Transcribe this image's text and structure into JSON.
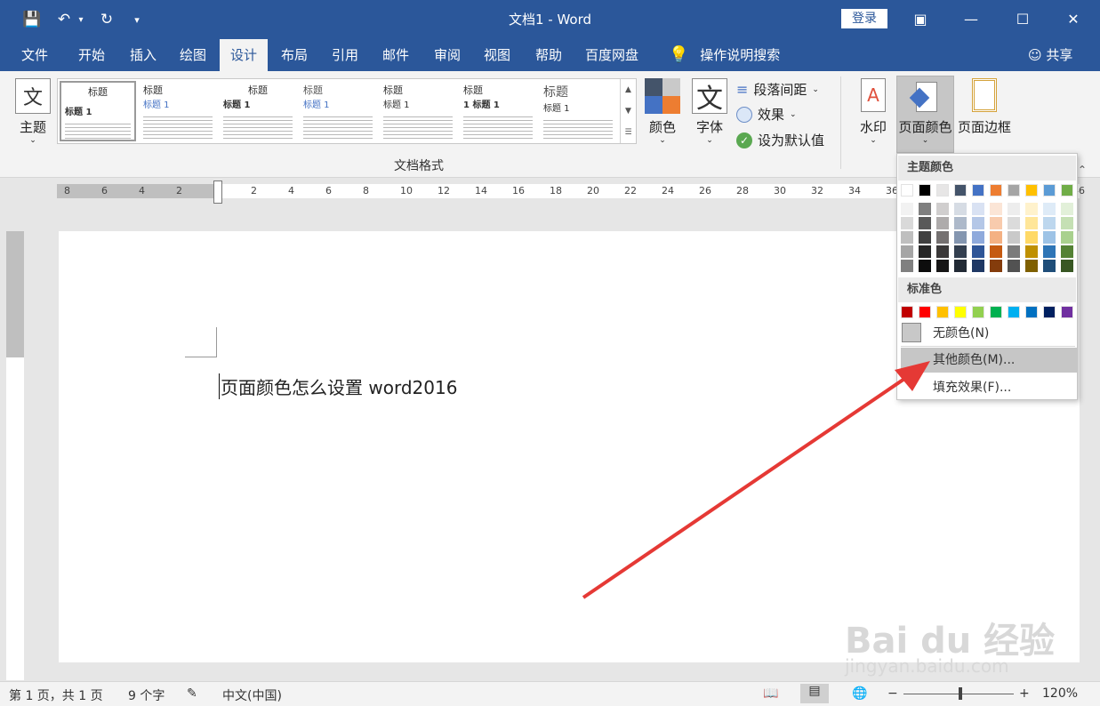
{
  "window": {
    "title": "文档1  -  Word",
    "login_label": "登录"
  },
  "tabs": [
    {
      "label": "文件"
    },
    {
      "label": "开始"
    },
    {
      "label": "插入"
    },
    {
      "label": "绘图"
    },
    {
      "label": "设计"
    },
    {
      "label": "布局"
    },
    {
      "label": "引用"
    },
    {
      "label": "邮件"
    },
    {
      "label": "审阅"
    },
    {
      "label": "视图"
    },
    {
      "label": "帮助"
    },
    {
      "label": "百度网盘"
    }
  ],
  "active_tab": "设计",
  "tell_me": "操作说明搜索",
  "share": "共享",
  "ribbon": {
    "theme_label": "主题",
    "style_thumbs": [
      {
        "heading": "标题",
        "sub": "标题 1"
      },
      {
        "heading": "标题",
        "sub": "标题 1"
      },
      {
        "heading": "标题",
        "sub": "标题 1"
      },
      {
        "heading": "标题",
        "sub": "标题 1"
      },
      {
        "heading": "标题",
        "sub": "标题 1"
      },
      {
        "heading": "标题",
        "sub": "1  标题 1"
      },
      {
        "heading": "标题",
        "sub": "标题 1"
      }
    ],
    "group_label": "文档格式",
    "colors_label": "颜色",
    "fonts_label": "字体",
    "fonts_icon_glyph": "文",
    "paragraph_spacing": "段落间距",
    "effects": "效果",
    "set_default": "设为默认值",
    "watermark": "水印",
    "page_color": "页面颜色",
    "page_borders": "页面边框"
  },
  "ruler": {
    "labels": [
      "8",
      "6",
      "4",
      "2",
      "",
      "2",
      "4",
      "6",
      "8",
      "10",
      "12",
      "14",
      "16",
      "18",
      "20",
      "22",
      "24",
      "26",
      "28",
      "30",
      "32",
      "34",
      "36",
      "",
      "",
      "",
      "",
      "46"
    ]
  },
  "document": {
    "text": "页面颜色怎么设置 word2016"
  },
  "dropdown": {
    "theme_colors_header": "主题颜色",
    "standard_colors_header": "标准色",
    "theme_colors": [
      "#ffffff",
      "#000000",
      "#e7e6e6",
      "#44546a",
      "#4472c4",
      "#ed7d31",
      "#a5a5a5",
      "#ffc000",
      "#5b9bd5",
      "#70ad47"
    ],
    "tints": [
      [
        "#f2f2f2",
        "#d9d9d9",
        "#bfbfbf",
        "#a6a6a6",
        "#808080"
      ],
      [
        "#7f7f7f",
        "#595959",
        "#404040",
        "#262626",
        "#0d0d0d"
      ],
      [
        "#d0cece",
        "#aeabab",
        "#757171",
        "#3a3838",
        "#171616"
      ],
      [
        "#d6dce4",
        "#adb9ca",
        "#8496b0",
        "#333f4f",
        "#222a35"
      ],
      [
        "#d9e2f3",
        "#b4c7e7",
        "#8faadc",
        "#2f5597",
        "#1f3864"
      ],
      [
        "#fbe5d6",
        "#f8cbad",
        "#f4b183",
        "#c55a11",
        "#843c0c"
      ],
      [
        "#ededed",
        "#dbdbdb",
        "#c9c9c9",
        "#7b7b7b",
        "#525252"
      ],
      [
        "#fff2cc",
        "#ffe699",
        "#ffd966",
        "#bf9000",
        "#7f6000"
      ],
      [
        "#deebf7",
        "#bdd7ee",
        "#9dc3e6",
        "#2e75b6",
        "#1f4e79"
      ],
      [
        "#e2f0d9",
        "#c5e0b4",
        "#a9d18e",
        "#548235",
        "#385723"
      ]
    ],
    "standard_colors": [
      "#c00000",
      "#ff0000",
      "#ffc000",
      "#ffff00",
      "#92d050",
      "#00b050",
      "#00b0f0",
      "#0070c0",
      "#002060",
      "#7030a0"
    ],
    "no_color": "无颜色(N)",
    "more_colors": "其他颜色(M)...",
    "fill_effects": "填充效果(F)..."
  },
  "statusbar": {
    "page": "第 1 页，共 1 页",
    "words": "9 个字",
    "language": "中文(中国)",
    "zoom": "120%",
    "zoom_level_percent": 120
  },
  "watermark_text": {
    "brand": "Bai du 经验",
    "url": "jingyan.baidu.com"
  },
  "colors": {
    "accent": "#2b579a",
    "arrow": "#e53935"
  }
}
